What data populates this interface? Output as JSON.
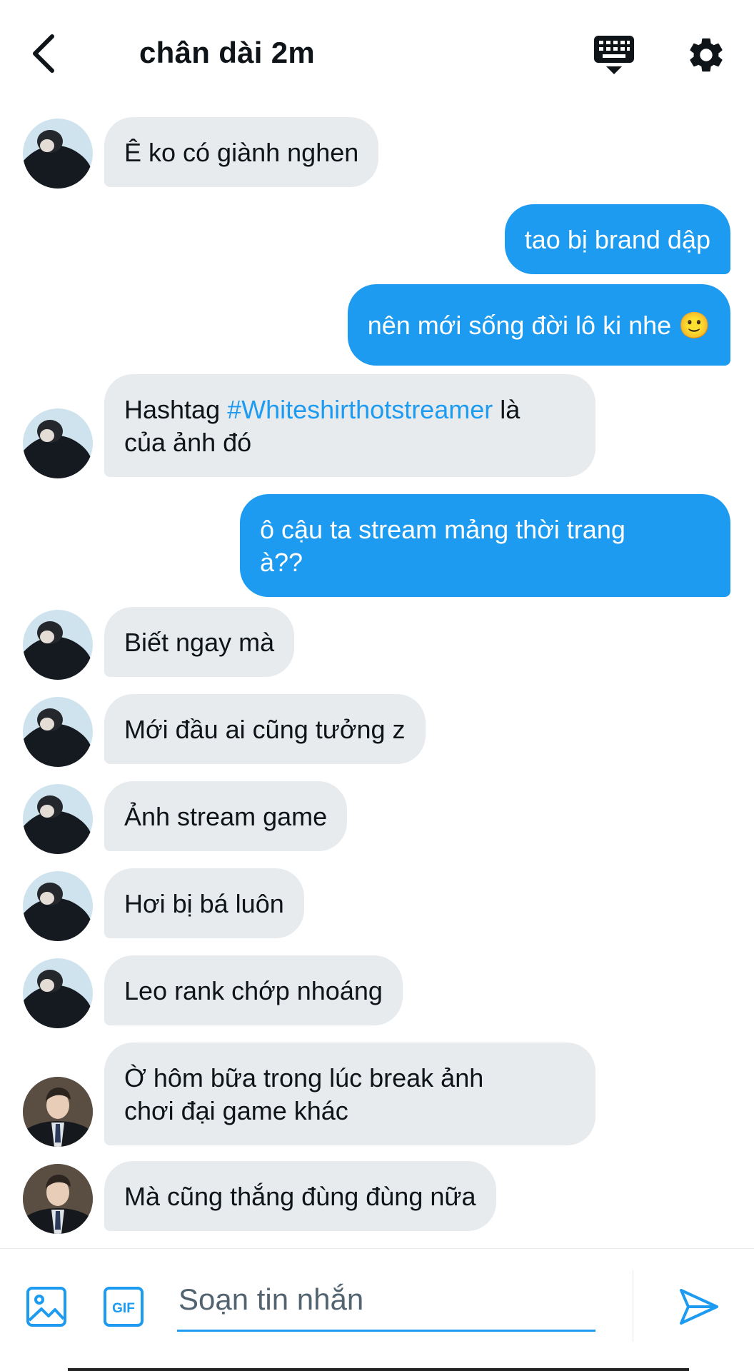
{
  "header": {
    "title": "chân dài 2m"
  },
  "messages": [
    {
      "side": "in",
      "text": "Ê ko có giành nghen"
    },
    {
      "side": "out",
      "text": "tao bị brand dập"
    },
    {
      "side": "out",
      "text": "nên mới sống đời lô ki nhe",
      "emoji": "🙂"
    },
    {
      "side": "in",
      "prefix": "Hashtag ",
      "hashtag": "#Whiteshirthotstreamer",
      "suffix": " là",
      "line2": "của ảnh đó"
    },
    {
      "side": "out",
      "line1": "ô cậu ta stream mảng thời trang",
      "line2": "à??"
    },
    {
      "side": "in",
      "text": "Biết ngay mà"
    },
    {
      "side": "in",
      "text": "Mới đầu ai cũng tưởng z"
    },
    {
      "side": "in",
      "text": "Ảnh stream game"
    },
    {
      "side": "in",
      "text": "Hơi bị bá luôn"
    },
    {
      "side": "in",
      "text": "Leo rank chớp nhoáng"
    },
    {
      "side": "in",
      "line1": "Ờ hôm bữa trong lúc break ảnh",
      "line2": "chơi đại game khác"
    },
    {
      "side": "in",
      "text": "Mà cũng thắng đùng đùng nữa"
    }
  ],
  "composer": {
    "placeholder": "Soạn tin nhắn",
    "gif_label": "GIF"
  },
  "icons": {
    "back": "chevron-left-icon",
    "keyboard": "keyboard-icon",
    "settings": "gear-icon",
    "image": "image-icon",
    "gif": "gif-icon",
    "send": "send-icon"
  },
  "colors": {
    "accent": "#1d9bf0",
    "incoming_bubble": "#e8ebee",
    "text": "#0f1419"
  }
}
